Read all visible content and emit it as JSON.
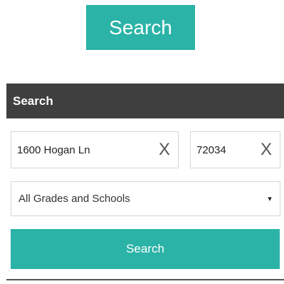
{
  "top_button": {
    "label": "Search"
  },
  "panel": {
    "title": "Search"
  },
  "address": {
    "value": "1600 Hogan Ln",
    "clear_icon": "X"
  },
  "zip": {
    "value": "72034",
    "clear_icon": "X"
  },
  "grade_select": {
    "selected": "All Grades and Schools",
    "arrow": "▾"
  },
  "submit_button": {
    "label": "Search"
  },
  "colors": {
    "accent": "#2ab3a6",
    "header_bg": "#3f3f3f",
    "field_border": "#d6d6d6"
  }
}
